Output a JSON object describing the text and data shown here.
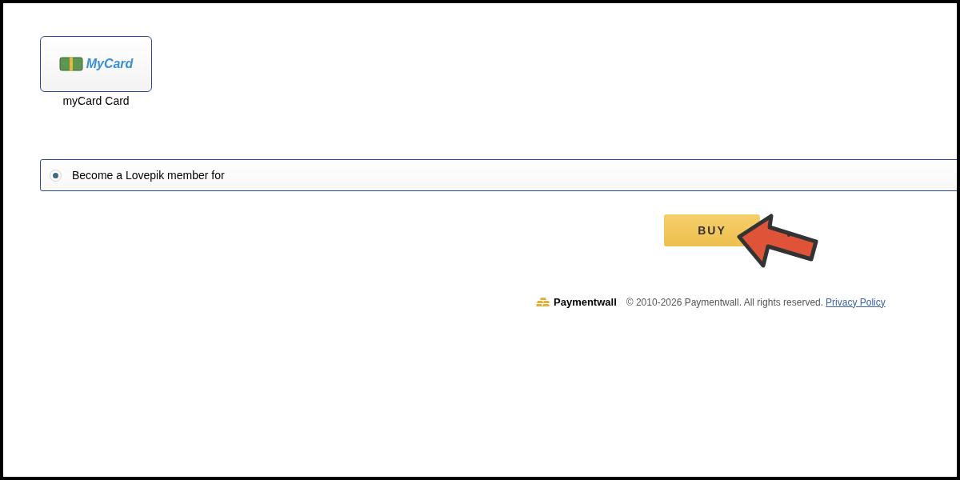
{
  "payment_methods": [
    {
      "logo_text": "MyCard",
      "label": "myCard Card",
      "selected": true
    }
  ],
  "offers": [
    {
      "label": "Become a Lovepik member for",
      "selected": true
    }
  ],
  "buy_button": "BUY",
  "footer": {
    "brand": "Paymentwall",
    "copyright": "© 2010-2026 Paymentwall. All rights reserved.",
    "link": "Privacy Policy"
  }
}
